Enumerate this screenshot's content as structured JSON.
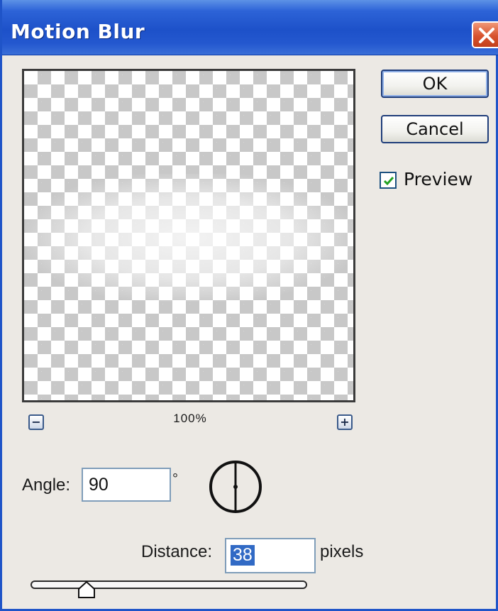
{
  "window": {
    "title": "Motion Blur"
  },
  "buttons": {
    "ok": "OK",
    "cancel": "Cancel"
  },
  "preview": {
    "label": "Preview",
    "checked": true,
    "zoom": "100%"
  },
  "angle": {
    "label": "Angle:",
    "value": "90",
    "unit": "°"
  },
  "distance": {
    "label": "Distance:",
    "value": "38",
    "unit": "pixels"
  },
  "icons": {
    "close": "close-icon",
    "zoom_out": "minus-icon",
    "zoom_in": "plus-icon",
    "check": "checkmark-icon",
    "dial": "angle-dial-icon",
    "thumb": "slider-thumb-icon"
  },
  "colors": {
    "title_bar": "#2458cf",
    "selection": "#316ac5",
    "close_button": "#d8532e",
    "dialog_background": "#ece9e4"
  }
}
